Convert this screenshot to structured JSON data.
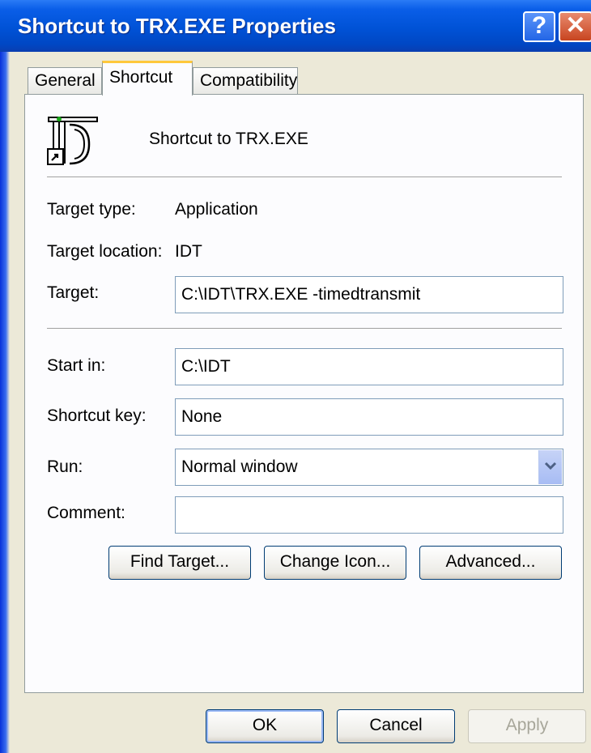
{
  "window": {
    "title": "Shortcut to TRX.EXE Properties",
    "help_label": "?",
    "close_label": "✕"
  },
  "tabs": [
    {
      "label": "General"
    },
    {
      "label": "Shortcut",
      "active": true
    },
    {
      "label": "Compatibility"
    }
  ],
  "shortcut": {
    "name": "Shortcut to TRX.EXE",
    "target_type_label": "Target type:",
    "target_type_value": "Application",
    "target_location_label": "Target location:",
    "target_location_value": "IDT",
    "target_label": "Target:",
    "target_value": "C:\\IDT\\TRX.EXE -timedtransmit",
    "start_in_label": "Start in:",
    "start_in_value": "C:\\IDT",
    "shortcut_key_label": "Shortcut key:",
    "shortcut_key_value": "None",
    "run_label": "Run:",
    "run_value": "Normal window",
    "comment_label": "Comment:",
    "comment_value": "",
    "find_target_label": "Find Target...",
    "change_icon_label": "Change Icon...",
    "advanced_label": "Advanced..."
  },
  "footer": {
    "ok_label": "OK",
    "cancel_label": "Cancel",
    "apply_label": "Apply"
  },
  "colors": {
    "titlebar": "#0052d6",
    "dialog_bg": "#ece9d8",
    "close_button": "#c84520",
    "active_tab_accent": "#ffc83c"
  },
  "icons": {
    "shortcut_icon": "program-icon-with-shortcut-arrow",
    "run_dropdown": "chevron-down-icon"
  }
}
